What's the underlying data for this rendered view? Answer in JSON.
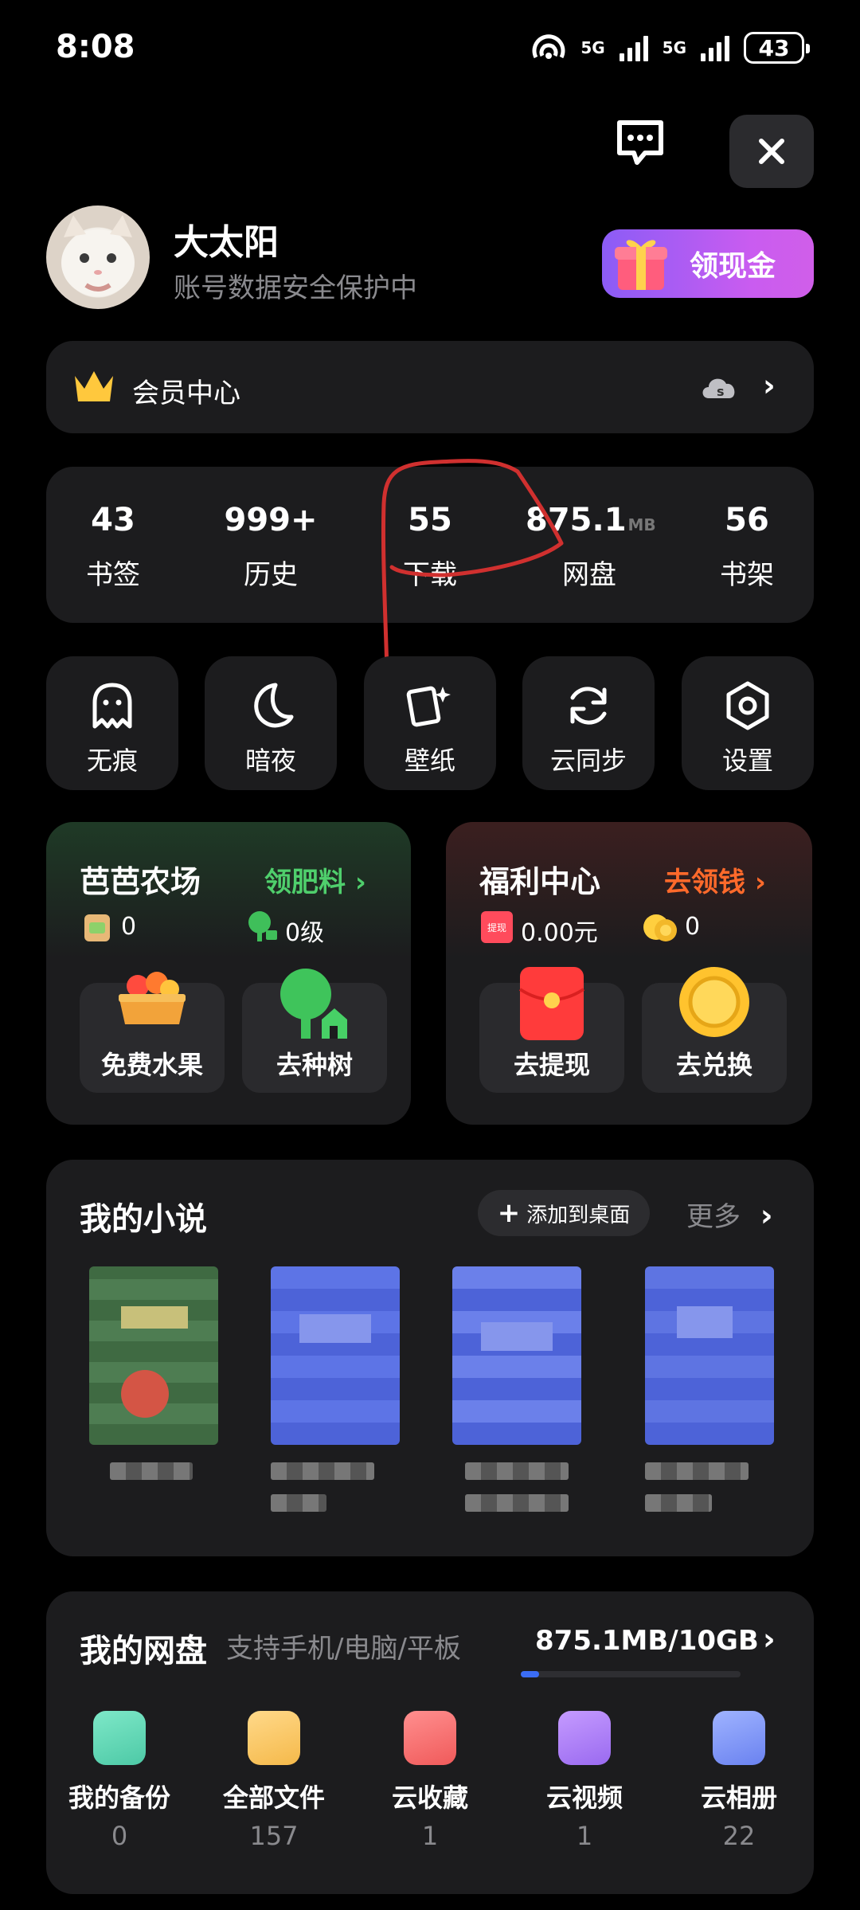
{
  "status": {
    "time": "8:08",
    "net1": "5G",
    "net2": "5G",
    "battery": "43"
  },
  "profile": {
    "name": "大太阳",
    "subtitle": "账号数据安全保护中",
    "cash_button": "领现金"
  },
  "vip": {
    "label": "会员中心"
  },
  "stats": [
    {
      "num": "43",
      "label": "书签"
    },
    {
      "num": "999+",
      "label": "历史"
    },
    {
      "num": "55",
      "label": "下载"
    },
    {
      "num": "875.1",
      "unit": "MB",
      "label": "网盘"
    },
    {
      "num": "56",
      "label": "书架"
    }
  ],
  "quick": [
    {
      "label": "无痕",
      "icon": "ghost-icon"
    },
    {
      "label": "暗夜",
      "icon": "moon-icon"
    },
    {
      "label": "壁纸",
      "icon": "wallpaper-icon"
    },
    {
      "label": "云同步",
      "icon": "sync-icon"
    },
    {
      "label": "设置",
      "icon": "settings-icon"
    }
  ],
  "farm": {
    "title": "芭芭农场",
    "link": "领肥料",
    "fertilizer": "0",
    "tree_level": "0级",
    "tile1": "免费水果",
    "tile2": "去种树"
  },
  "welfare": {
    "title": "福利中心",
    "link": "去领钱",
    "withdraw_tag": "提现",
    "cash": "0.00元",
    "coins": "0",
    "tile1": "去提现",
    "tile2": "去兑换"
  },
  "novels": {
    "title": "我的小说",
    "add_to_desktop": "添加到桌面",
    "more": "更多"
  },
  "cloud": {
    "title": "我的网盘",
    "subtitle": "支持手机/电脑/平板",
    "usage": "875.1MB/10GB",
    "usage_fraction": 0.085,
    "items": [
      {
        "label": "我的备份",
        "count": "0"
      },
      {
        "label": "全部文件",
        "count": "157"
      },
      {
        "label": "云收藏",
        "count": "1"
      },
      {
        "label": "云视频",
        "count": "1"
      },
      {
        "label": "云相册",
        "count": "22"
      }
    ]
  },
  "colors": {
    "card": "#1c1c1e",
    "green": "#4fcf6c",
    "orange": "#ff6a2b",
    "purple": "#b05cf2",
    "blue": "#3b6df5"
  }
}
